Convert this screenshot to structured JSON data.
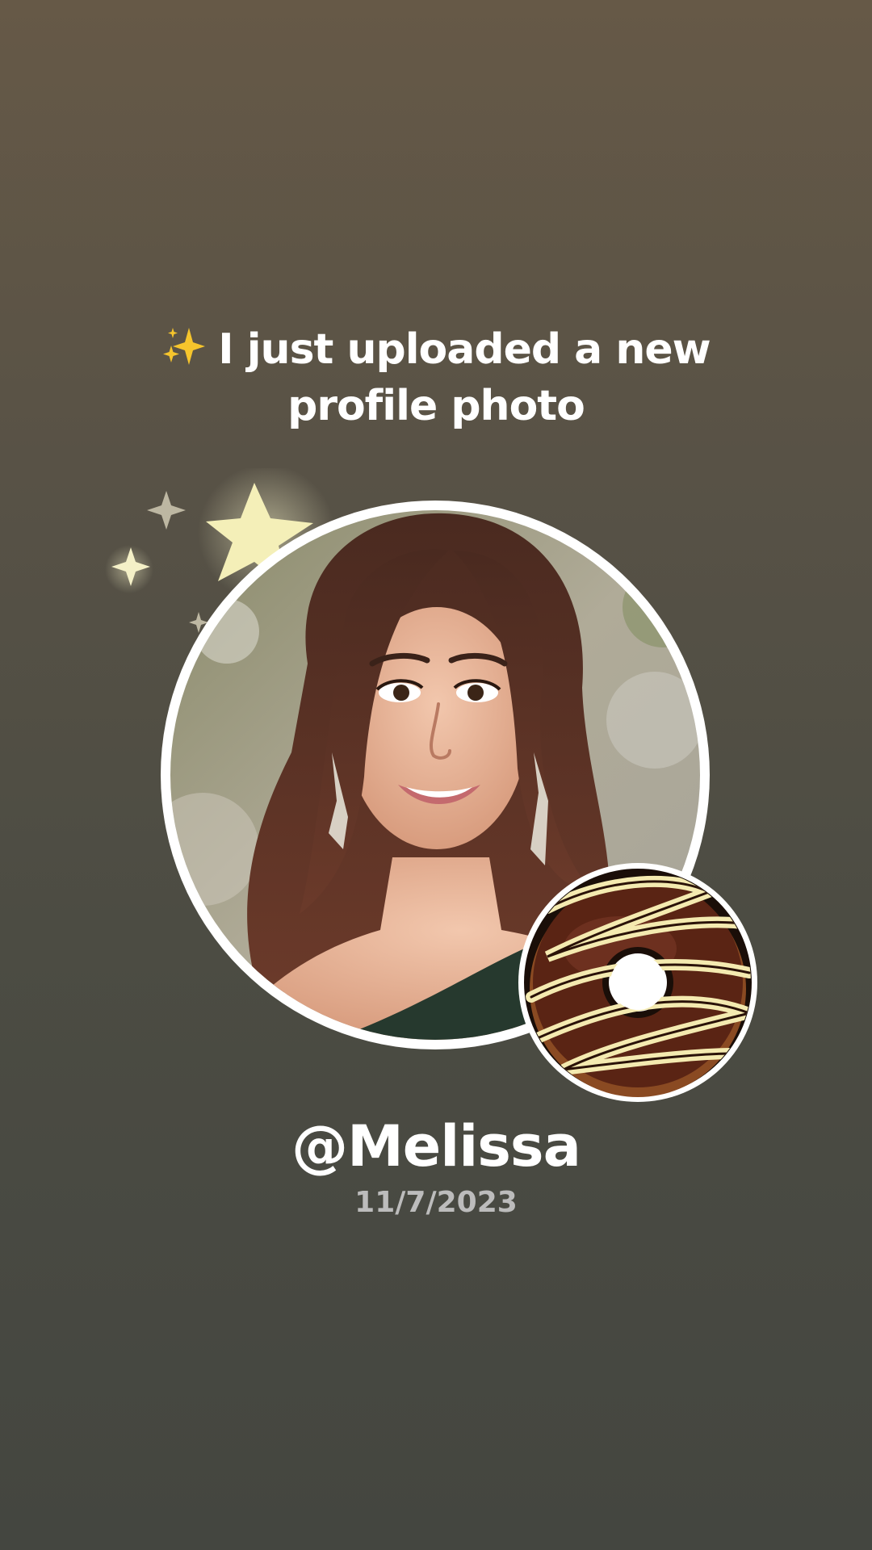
{
  "announcement": {
    "emoji": "sparkles-icon",
    "line1": "I just uploaded a new",
    "line2": "profile photo"
  },
  "profile": {
    "username": "@Melissa",
    "date": "11/7/2023"
  },
  "decorations": {
    "stars": "sparkle-stars-icon",
    "sticker": "donut-sticker"
  },
  "colors": {
    "background_top": "#665947",
    "background_bottom": "#444640",
    "text_primary": "#ffffff",
    "text_secondary": "#bcbcbc",
    "ring": "#ffffff"
  }
}
